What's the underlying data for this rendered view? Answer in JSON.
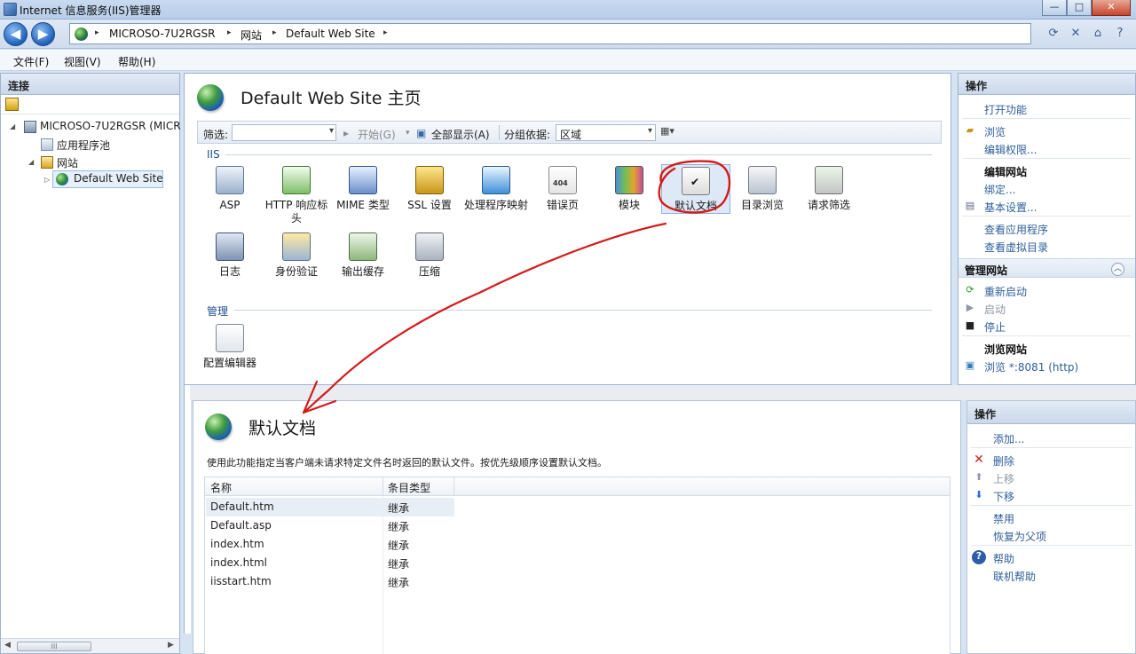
{
  "window": {
    "title": "Internet 信息服务(IIS)管理器",
    "min": "—",
    "max": "□",
    "close": "✕"
  },
  "nav": {
    "back": "◀",
    "forward": "▶",
    "breadcrumbs": [
      "MICROSO-7U2RGSR",
      "网站",
      "Default Web Site"
    ],
    "sep": "▸"
  },
  "menu": [
    "文件(F)",
    "视图(V)",
    "帮助(H)"
  ],
  "connections": {
    "header": "连接",
    "tree": [
      {
        "label": "MICROSO-7U2RGSR (MICR",
        "icon": "server-icon"
      },
      {
        "label": "应用程序池",
        "icon": "app-pool-icon"
      },
      {
        "label": "网站",
        "icon": "sites-folder-icon"
      },
      {
        "label": "Default Web Site",
        "icon": "globe-icon"
      }
    ],
    "scroll_thumb": "III"
  },
  "main": {
    "title": "Default Web Site 主页",
    "filter": {
      "label": "筛选:",
      "start": "开始(G)",
      "show_all": "全部显示(A)",
      "group_label": "分组依据:",
      "group_value": "区域"
    },
    "sections": {
      "iis": "IIS",
      "manage": "管理"
    },
    "features": [
      {
        "label": "ASP",
        "icon": "asp-icon"
      },
      {
        "label": "HTTP 响应标头",
        "icon": "http-headers-icon"
      },
      {
        "label": "MIME 类型",
        "icon": "mime-types-icon"
      },
      {
        "label": "SSL 设置",
        "icon": "ssl-lock-icon"
      },
      {
        "label": "处理程序映射",
        "icon": "handler-mappings-icon"
      },
      {
        "label": "错误页",
        "icon": "error-pages-icon"
      },
      {
        "label": "模块",
        "icon": "modules-icon"
      },
      {
        "label": "默认文档",
        "icon": "default-document-icon"
      },
      {
        "label": "目录浏览",
        "icon": "directory-browsing-icon"
      },
      {
        "label": "请求筛选",
        "icon": "request-filtering-icon"
      },
      {
        "label": "日志",
        "icon": "logging-icon"
      },
      {
        "label": "身份验证",
        "icon": "authentication-icon"
      },
      {
        "label": "输出缓存",
        "icon": "output-caching-icon"
      },
      {
        "label": "压缩",
        "icon": "compression-icon"
      }
    ],
    "manage_features": [
      {
        "label": "配置编辑器",
        "icon": "configuration-editor-icon"
      }
    ]
  },
  "actions": {
    "header": "操作",
    "open_feature": "打开功能",
    "browse": "浏览",
    "edit_permissions": "编辑权限...",
    "edit_site": "编辑网站",
    "bindings": "绑定...",
    "basic_settings": "基本设置...",
    "view_apps": "查看应用程序",
    "view_vdirs": "查看虚拟目录",
    "manage_site": "管理网站",
    "restart": "重新启动",
    "start": "启动",
    "stop": "停止",
    "browse_site": "浏览网站",
    "browse_port": "浏览 *:8081 (http)"
  },
  "default_doc": {
    "title": "默认文档",
    "description": "使用此功能指定当客户端未请求特定文件名时返回的默认文件。按优先级顺序设置默认文档。",
    "columns": [
      "名称",
      "条目类型"
    ],
    "rows": [
      {
        "name": "Default.htm",
        "type": "继承"
      },
      {
        "name": "Default.asp",
        "type": "继承"
      },
      {
        "name": "index.htm",
        "type": "继承"
      },
      {
        "name": "index.html",
        "type": "继承"
      },
      {
        "name": "iisstart.htm",
        "type": "继承"
      }
    ],
    "actions": {
      "header": "操作",
      "add": "添加...",
      "remove": "删除",
      "move_up": "上移",
      "move_down": "下移",
      "disable": "禁用",
      "revert": "恢复为父项",
      "help": "帮助",
      "online_help": "联机帮助"
    }
  },
  "colors": {
    "annotation": "#d41a1a",
    "link": "#2f5f9a",
    "disabled": "#8f98a3"
  }
}
